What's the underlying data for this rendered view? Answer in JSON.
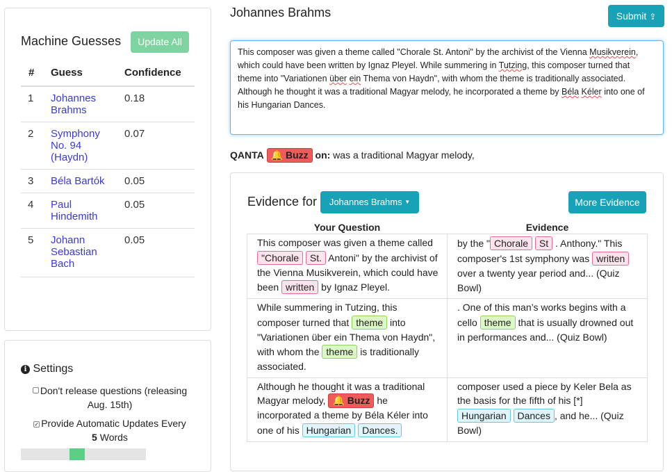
{
  "guesses_panel": {
    "title": "Machine Guesses",
    "update_all_label": "Update All",
    "columns": [
      "#",
      "Guess",
      "Confidence"
    ],
    "rows": [
      {
        "rank": "1",
        "guess": "Johannes Brahms",
        "confidence": "0.18"
      },
      {
        "rank": "2",
        "guess": "Symphony No. 94 (Haydn)",
        "confidence": "0.07"
      },
      {
        "rank": "3",
        "guess": "Béla Bartók",
        "confidence": "0.05"
      },
      {
        "rank": "4",
        "guess": "Paul Hindemith",
        "confidence": "0.05"
      },
      {
        "rank": "5",
        "guess": "Johann Sebastian Bach",
        "confidence": "0.05"
      }
    ]
  },
  "settings": {
    "title": "Settings",
    "option1_label": "Don't release questions (releasing Aug. 15th)",
    "option1_checked": false,
    "option2_label": "Provide Automatic Updates Every",
    "option2_checked": true,
    "update_count": "5",
    "update_unit": "Words",
    "slider_value": 5
  },
  "header": {
    "answer": "Johannes Brahms",
    "submit_label": "Submit"
  },
  "question": {
    "s1a": "This composer was given a theme called \"Chorale St. Antoni\" by the archivist of the Vienna",
    "s1b": "Musikverein",
    "s1c": ", which could have been written by Ignaz Pleyel.  While summering in ",
    "s1d": "Tutzing",
    "s1e": ", this composer turned that theme into \"Variationen ",
    "s1f": "über",
    "s1g": " ",
    "s1h": "ein",
    "s1i": " Thema von Haydn\", with whom the theme is traditionally associated.  Although he thought it was a traditional Magyar melody, he incorporated a theme by ",
    "s1j": "Béla",
    "s1k": " ",
    "s1l": "Kéler",
    "s1m": " into one of his Hungarian Dances."
  },
  "buzz_line": {
    "system": "QANTA",
    "buzz_label": "Buzz",
    "on_label": "on:",
    "text": "was a traditional Magyar melody,"
  },
  "evidence": {
    "title": "Evidence for",
    "dropdown_label": "Johannes Brahms",
    "more_label": "More Evidence",
    "col_question": "Your Question",
    "col_evidence": "Evidence",
    "r1q": {
      "a": "This composer was given a theme called",
      "hl1": "\"Chorale",
      "hl2": "St.",
      "b": "Antoni\" by the archivist of the Vienna Musikverein, which could have been",
      "hl3": "written",
      "c": "by Ignaz Pleyel."
    },
    "r1e": {
      "a": "by the \"",
      "hl1": "Chorale",
      "hl2": "St",
      "b": ". Anthony.\" This composer's 1st symphony was",
      "hl3": "written",
      "c": "over a twenty year period and... (Quiz Bowl)"
    },
    "r2q": {
      "a": "While summering in Tutzing, this composer turned that",
      "hl1": "theme",
      "b": "into \"Variationen über ein Thema von Haydn\", with whom the",
      "hl2": "theme",
      "c": "is traditionally associated."
    },
    "r2e": {
      "a": ". One of this man’s works begins with a cello",
      "hl1": "theme",
      "b": "that is usually drowned out in performances and... (Quiz Bowl)"
    },
    "r3q": {
      "a": "Although he thought it was a traditional Magyar melody,",
      "buzz": "Buzz",
      "b": "he incorporated a theme by Béla Kéler into one of his",
      "hl1": "Hungarian",
      "hl2": "Dances."
    },
    "r3e": {
      "a": "composer used a piece by Keler Bela as the basis for the fifth of his [*]",
      "hl1": "Hungarian",
      "hl2": "Dances",
      "b": ", and he... (Quiz Bowl)"
    }
  },
  "colors": {
    "teal": "#17a2b8",
    "green_button": "#7fd3a1",
    "link": "#3a3ad6",
    "buzz_red": "#ef5a5a",
    "pink_highlight": "#fde3ec",
    "green_highlight": "#dcf8c6",
    "blue_highlight": "#dff5fb"
  }
}
